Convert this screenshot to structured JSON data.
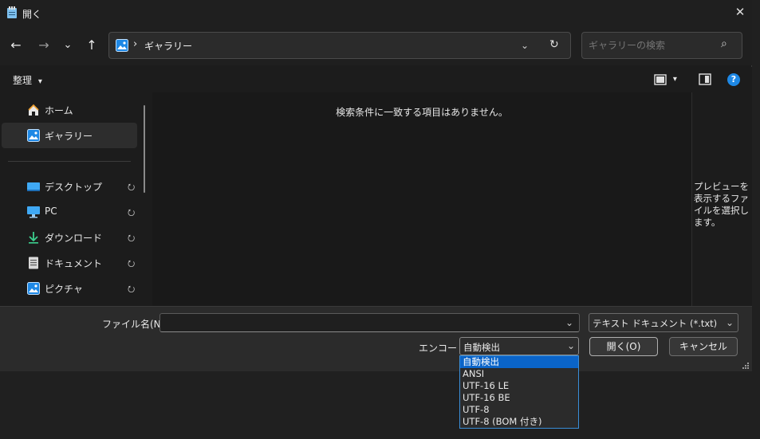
{
  "window": {
    "title": "開く",
    "close_label": "✕"
  },
  "nav": {
    "back": "←",
    "forward": "→",
    "recent": "⌄",
    "up": "↑",
    "address": {
      "separator": "›",
      "location": "ギャラリー",
      "dropdown": "⌄",
      "refresh": "↻"
    },
    "search": {
      "placeholder": "ギャラリーの検索",
      "icon": "⌕"
    }
  },
  "toolbar": {
    "organize_label": "整理",
    "organize_chevron": "▾",
    "view_chevron": "▾",
    "help": "?"
  },
  "sidebar": {
    "items": [
      {
        "label": "ホーム",
        "icon": "home-icon"
      },
      {
        "label": "ギャラリー",
        "icon": "gallery-icon",
        "selected": true
      },
      {
        "label": "デスクトップ",
        "icon": "desktop-icon",
        "pinned": true
      },
      {
        "label": "PC",
        "icon": "pc-icon",
        "pinned": true
      },
      {
        "label": "ダウンロード",
        "icon": "download-icon",
        "pinned": true
      },
      {
        "label": "ドキュメント",
        "icon": "document-icon",
        "pinned": true
      },
      {
        "label": "ピクチャ",
        "icon": "pictures-icon",
        "pinned": true
      }
    ],
    "pin_glyph": "📌"
  },
  "content": {
    "empty_message": "検索条件に一致する項目はありません。"
  },
  "preview": {
    "message": "プレビューを表示するファイルを選択します。"
  },
  "bottom": {
    "filename_label": "ファイル名(N):",
    "filename_value": "",
    "filetype_value": "テキスト ドキュメント (*.txt)",
    "encoding_label": "エンコード:",
    "encoding_value": "自動検出",
    "open_button": "開く(O)",
    "cancel_button": "キャンセル",
    "chevron": "⌄"
  },
  "encoding_dropdown": {
    "options": [
      "自動検出",
      "ANSI",
      "UTF-16 LE",
      "UTF-16 BE",
      "UTF-8",
      "UTF-8 (BOM 付き)"
    ],
    "selected_index": 0
  },
  "colors": {
    "accent": "#0a64c8",
    "help_blue": "#1e88e5"
  }
}
